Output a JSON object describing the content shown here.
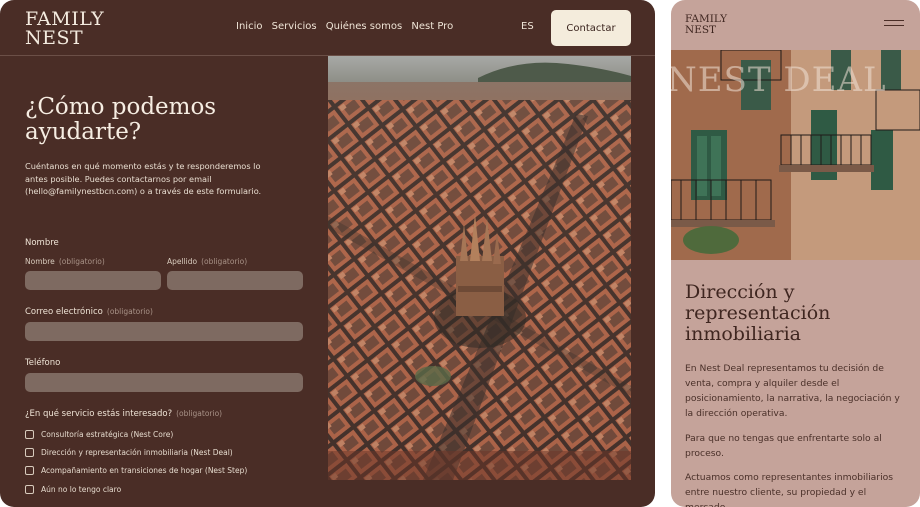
{
  "desktop": {
    "logo": {
      "line1": "FAMILY",
      "line2": "NEST"
    },
    "nav": [
      "Inicio",
      "Servicios",
      "Quiénes somos",
      "Nest Pro"
    ],
    "lang": "ES",
    "cta": "Contactar",
    "heading": "¿Cómo podemos ayudarte?",
    "intro": "Cuéntanos en qué momento estás y te responderemos lo antes posible. Puedes contactarnos por email (hello@familynestbcn.com) o a través de este formulario.",
    "form": {
      "name_group": "Nombre",
      "first_name": "Nombre",
      "last_name": "Apellido",
      "required": "(obligatorio)",
      "email": "Correo electrónico",
      "phone": "Teléfono",
      "service_question": "¿En qué servicio estás interesado?",
      "options": [
        "Consultoría estratégica (Nest Core)",
        "Dirección y representación inmobiliaria (Nest Deal)",
        "Acompañamiento en transiciones de hogar (Nest Step)",
        "Aún no lo tengo claro"
      ]
    }
  },
  "mobile": {
    "logo": {
      "line1": "FAMILY",
      "line2": "NEST"
    },
    "overlay": "NEST DEAL",
    "heading": "Dirección y representación inmobiliaria",
    "paragraphs": [
      "En Nest Deal representamos tu decisión de venta, compra y alquiler desde el posicionamiento, la narrativa, la negociación y la dirección operativa.",
      "Para que no tengas que enfrentarte solo al proceso.",
      "Actuamos como representantes inmobiliarios entre nuestro cliente, su propiedad y el mercado."
    ]
  },
  "colors": {
    "desktop_bg": "#4a2d26",
    "mobile_bg": "#c5a39a",
    "cta_bg": "#f4ecdc"
  }
}
